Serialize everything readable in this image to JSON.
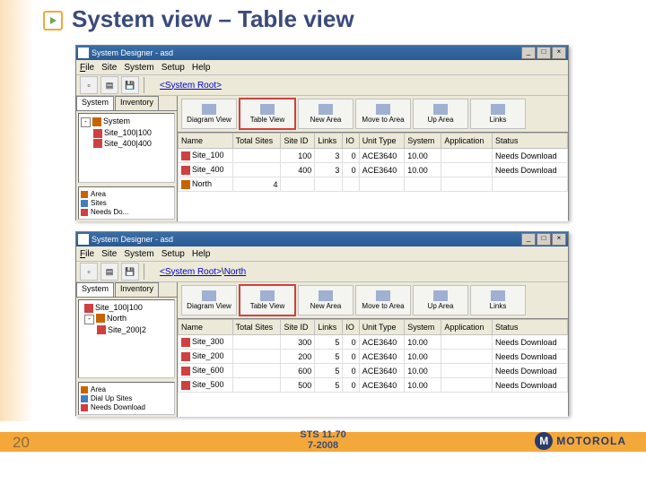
{
  "slide": {
    "title": "System view – Table view",
    "page_number": "20",
    "footer_line1": "STS 11.70",
    "footer_line2": "7-2008",
    "logo_text": "MOTOROLA",
    "logo_glyph": "M"
  },
  "app1": {
    "window_title": "System Designer - asd",
    "menus": {
      "file": "File",
      "site": "Site",
      "system": "System",
      "setup": "Setup",
      "help": "Help"
    },
    "breadcrumb_root": "<System Root>",
    "tabs": {
      "system": "System",
      "inventory": "Inventory"
    },
    "tree": {
      "root": "System",
      "children": [
        "Site_100|100",
        "Site_400|400"
      ]
    },
    "legend": {
      "area": "Area",
      "sites": "Sites",
      "needs": "Needs Do..."
    },
    "viewbar": {
      "diagram": "Diagram View",
      "table": "Table View",
      "newarea": "New Area",
      "moveto": "Move to Area",
      "uparea": "Up Area",
      "links": "Links"
    },
    "columns": [
      "Name",
      "Total Sites",
      "Site ID",
      "Links",
      "IO",
      "Unit Type",
      "System",
      "Application",
      "Status"
    ],
    "rows": [
      {
        "icon": "site",
        "name": "Site_100",
        "total": "",
        "siteid": "100",
        "links": "3",
        "io": "0",
        "unit": "ACE3640",
        "sys": "10.00",
        "app": "",
        "status": "Needs Download"
      },
      {
        "icon": "site",
        "name": "Site_400",
        "total": "",
        "siteid": "400",
        "links": "3",
        "io": "0",
        "unit": "ACE3640",
        "sys": "10.00",
        "app": "",
        "status": "Needs Download"
      },
      {
        "icon": "area",
        "name": "North",
        "total": "4",
        "siteid": "",
        "links": "",
        "io": "",
        "unit": "",
        "sys": "",
        "app": "",
        "status": ""
      }
    ]
  },
  "app2": {
    "window_title": "System Designer - asd",
    "menus": {
      "file": "File",
      "site": "Site",
      "system": "System",
      "setup": "Setup",
      "help": "Help"
    },
    "breadcrumb_root": "<System Root>",
    "breadcrumb_leaf": "North",
    "tabs": {
      "system": "System",
      "inventory": "Inventory"
    },
    "tree": {
      "root_child": "Site_100|100",
      "folder": "North",
      "folder_child": "Site_200|2"
    },
    "legend": {
      "area": "Area",
      "sites": "Dial Up Sites",
      "needs": "Needs Download"
    },
    "viewbar": {
      "diagram": "Diagram View",
      "table": "Table View",
      "newarea": "New Area",
      "moveto": "Move to Area",
      "uparea": "Up Area",
      "links": "Links"
    },
    "columns": [
      "Name",
      "Total Sites",
      "Site ID",
      "Links",
      "IO",
      "Unit Type",
      "System",
      "Application",
      "Status"
    ],
    "rows": [
      {
        "icon": "site",
        "name": "Site_300",
        "total": "",
        "siteid": "300",
        "links": "5",
        "io": "0",
        "unit": "ACE3640",
        "sys": "10.00",
        "app": "",
        "status": "Needs Download"
      },
      {
        "icon": "site",
        "name": "Site_200",
        "total": "",
        "siteid": "200",
        "links": "5",
        "io": "0",
        "unit": "ACE3640",
        "sys": "10.00",
        "app": "",
        "status": "Needs Download"
      },
      {
        "icon": "site",
        "name": "Site_600",
        "total": "",
        "siteid": "600",
        "links": "5",
        "io": "0",
        "unit": "ACE3640",
        "sys": "10.00",
        "app": "",
        "status": "Needs Download"
      },
      {
        "icon": "site",
        "name": "Site_500",
        "total": "",
        "siteid": "500",
        "links": "5",
        "io": "0",
        "unit": "ACE3640",
        "sys": "10.00",
        "app": "",
        "status": "Needs Download"
      }
    ]
  }
}
